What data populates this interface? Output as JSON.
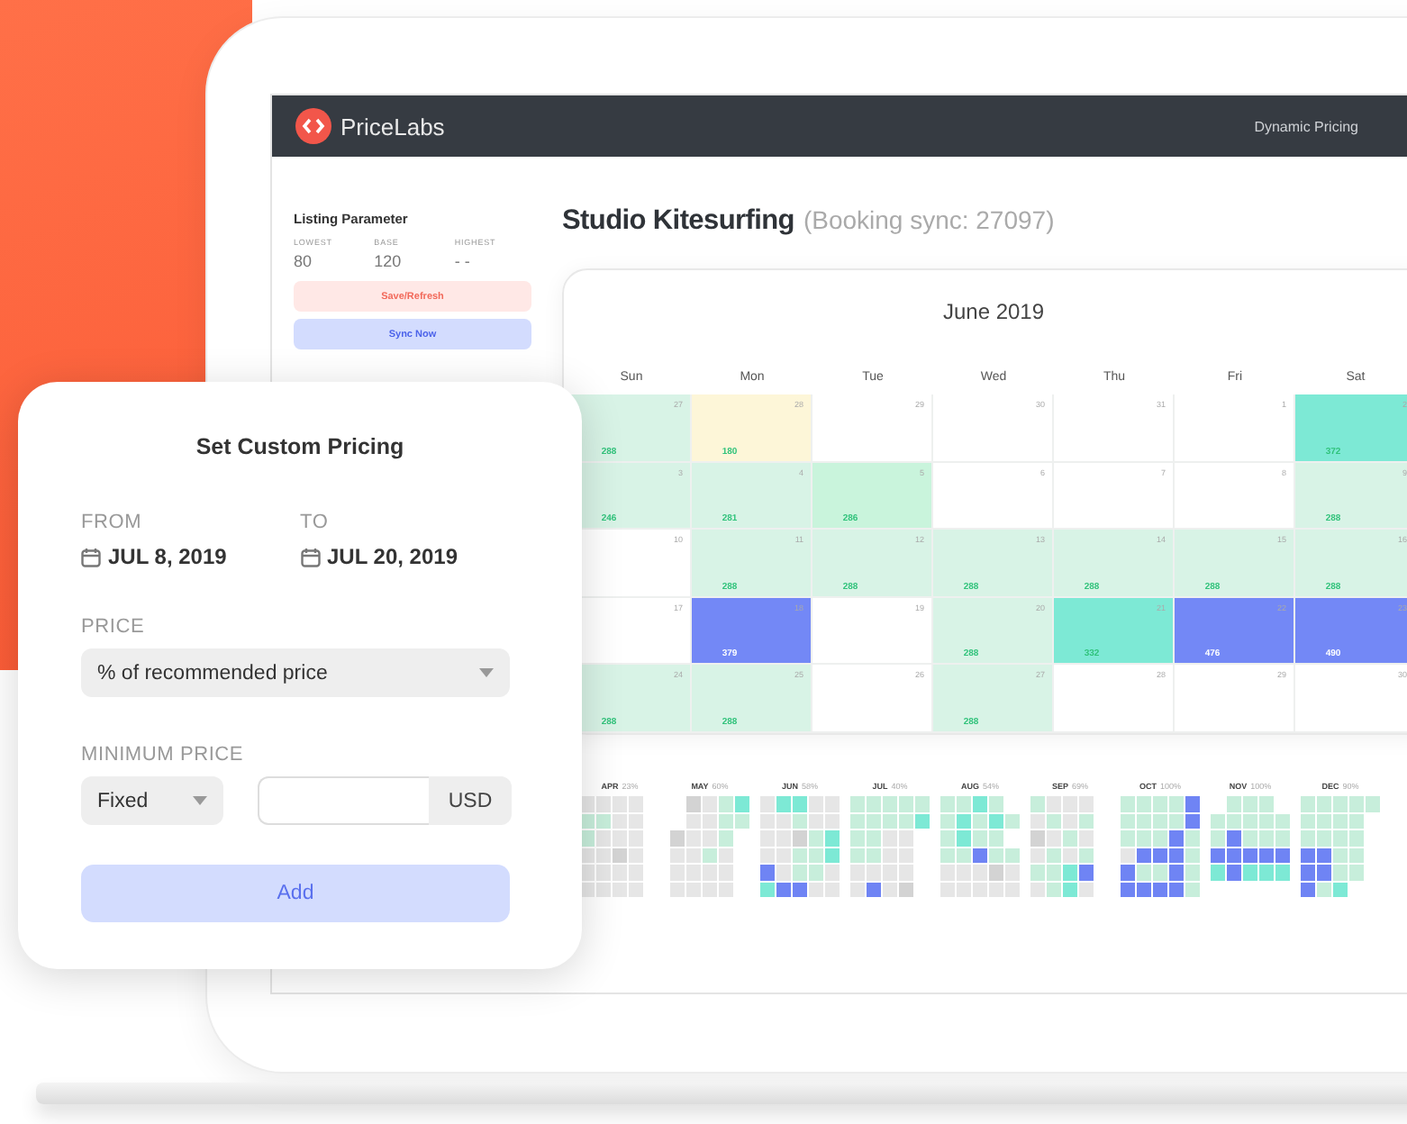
{
  "header": {
    "logo_text": "PriceLabs",
    "nav_link": "Dynamic Pricing"
  },
  "sidebar": {
    "title": "Listing Parameter",
    "params": [
      {
        "label": "LOWEST",
        "value": "80"
      },
      {
        "label": "BASE",
        "value": "120"
      },
      {
        "label": "HIGHEST",
        "value": "- -"
      }
    ],
    "buttons": [
      {
        "label": "Save/Refresh",
        "kind": "danger"
      },
      {
        "label": "Sync Now",
        "kind": "primary"
      }
    ]
  },
  "listing": {
    "name": "Studio Kitesurfing",
    "sync": "(Booking sync: 27097)"
  },
  "calendar": {
    "month": "June 2019",
    "weekdays": [
      "Sun",
      "Mon",
      "Tue",
      "Wed",
      "Thu",
      "Fri",
      "Sat"
    ],
    "weeks": [
      [
        {
          "day": "27",
          "price": "288",
          "color": "#d8f3e6"
        },
        {
          "day": "28",
          "price": "180",
          "color": "#fdf6d8"
        },
        {
          "day": "29",
          "color": "#ffffff"
        },
        {
          "day": "30",
          "color": "#ffffff"
        },
        {
          "day": "31",
          "color": "#ffffff"
        },
        {
          "day": "1",
          "color": "#ffffff"
        },
        {
          "day": "2",
          "price": "372",
          "color": "#7de9d5"
        }
      ],
      [
        {
          "day": "3",
          "price": "246",
          "color": "#d8f3e6"
        },
        {
          "day": "4",
          "price": "281",
          "color": "#d8f3e6"
        },
        {
          "day": "5",
          "price": "286",
          "color": "#c9f4dc"
        },
        {
          "day": "6",
          "color": "#ffffff"
        },
        {
          "day": "7",
          "color": "#ffffff"
        },
        {
          "day": "8",
          "color": "#ffffff"
        },
        {
          "day": "9",
          "price": "288",
          "color": "#d8f3e6"
        }
      ],
      [
        {
          "day": "10",
          "color": "#ffffff"
        },
        {
          "day": "11",
          "price": "288",
          "color": "#d8f3e6"
        },
        {
          "day": "12",
          "price": "288",
          "color": "#d8f3e6"
        },
        {
          "day": "13",
          "price": "288",
          "color": "#d8f3e6"
        },
        {
          "day": "14",
          "price": "288",
          "color": "#d8f3e6"
        },
        {
          "day": "15",
          "price": "288",
          "color": "#d8f3e6"
        },
        {
          "day": "16",
          "price": "288",
          "color": "#d8f3e6"
        }
      ],
      [
        {
          "day": "17",
          "color": "#ffffff"
        },
        {
          "day": "18",
          "price": "379",
          "color": "#7388f6"
        },
        {
          "day": "19",
          "color": "#ffffff"
        },
        {
          "day": "20",
          "price": "288",
          "color": "#d8f3e6"
        },
        {
          "day": "21",
          "price": "332",
          "color": "#7de9d5"
        },
        {
          "day": "22",
          "price": "476",
          "color": "#7388f6"
        },
        {
          "day": "23",
          "price": "490",
          "color": "#7388f6"
        }
      ],
      [
        {
          "day": "24",
          "price": "288",
          "color": "#d8f3e6"
        },
        {
          "day": "25",
          "price": "288",
          "color": "#d8f3e6"
        },
        {
          "day": "26",
          "color": "#ffffff"
        },
        {
          "day": "27",
          "price": "288",
          "color": "#d8f3e6"
        },
        {
          "day": "28",
          "color": "#ffffff"
        },
        {
          "day": "29",
          "color": "#ffffff"
        },
        {
          "day": "30",
          "color": "#ffffff"
        }
      ]
    ]
  },
  "year_overview": [
    {
      "month": "APR",
      "percent": "23%"
    },
    {
      "month": "MAY",
      "percent": "60%"
    },
    {
      "month": "JUN",
      "percent": "58%"
    },
    {
      "month": "JUL",
      "percent": "40%"
    },
    {
      "month": "AUG",
      "percent": "54%"
    },
    {
      "month": "SEP",
      "percent": "69%"
    },
    {
      "month": "OCT",
      "percent": "100%"
    },
    {
      "month": "NOV",
      "percent": "100%"
    },
    {
      "month": "DEC",
      "percent": "90%"
    }
  ],
  "dialog": {
    "title": "Set Custom Pricing",
    "from": {
      "label": "FROM",
      "value": "JUL 8, 2019"
    },
    "to": {
      "label": "TO",
      "value": "JUL 20, 2019"
    },
    "price": {
      "label": "PRICE",
      "value": "% of recommended price"
    },
    "minimum_price": {
      "label": "MINIMUM PRICE",
      "mode": "Fixed",
      "unit": "USD"
    },
    "add_button": "Add"
  }
}
